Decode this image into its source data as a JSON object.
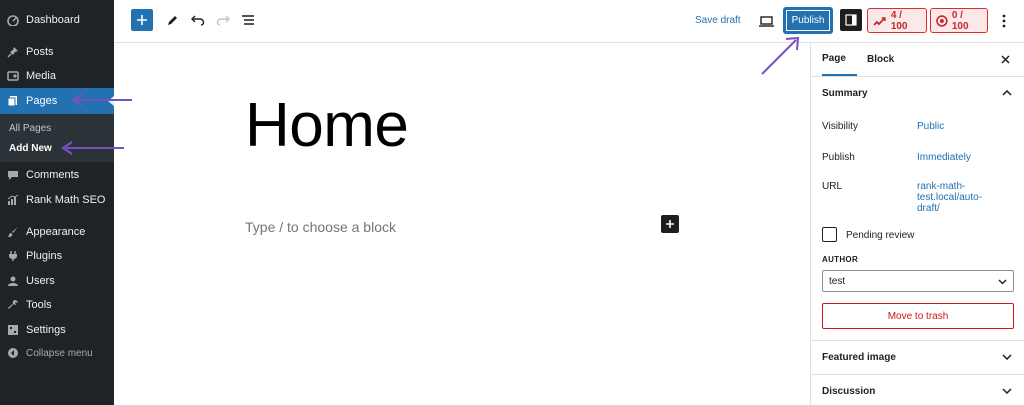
{
  "admin_menu": {
    "items": [
      {
        "label": "Dashboard",
        "icon": "dashboard-icon"
      },
      {
        "label": "Posts",
        "icon": "pin-icon"
      },
      {
        "label": "Media",
        "icon": "media-icon"
      },
      {
        "label": "Pages",
        "icon": "pages-icon",
        "active": true
      },
      {
        "label": "Comments",
        "icon": "comment-icon"
      },
      {
        "label": "Rank Math SEO",
        "icon": "chart-icon"
      },
      {
        "label": "Appearance",
        "icon": "brush-icon"
      },
      {
        "label": "Plugins",
        "icon": "plugin-icon"
      },
      {
        "label": "Users",
        "icon": "user-icon"
      },
      {
        "label": "Tools",
        "icon": "wrench-icon"
      },
      {
        "label": "Settings",
        "icon": "settings-icon"
      },
      {
        "label": "Collapse menu",
        "icon": "collapse-icon"
      }
    ],
    "submenu": [
      "All Pages",
      "Add New"
    ]
  },
  "toolbar": {
    "save_draft": "Save draft",
    "publish": "Publish",
    "seo_score": "4 / 100",
    "content_score": "0 / 100"
  },
  "editor": {
    "title": "Home",
    "placeholder": "Type / to choose a block"
  },
  "settings_panel": {
    "tabs": [
      "Page",
      "Block"
    ],
    "summary_title": "Summary",
    "visibility_label": "Visibility",
    "visibility_value": "Public",
    "publish_label": "Publish",
    "publish_value": "Immediately",
    "url_label": "URL",
    "url_lines": [
      "rank-math-",
      "test.local/auto-",
      "draft/"
    ],
    "pending_review": "Pending review",
    "author_label": "AUTHOR",
    "author_value": "test",
    "trash_label": "Move to trash",
    "featured_image": "Featured image",
    "discussion": "Discussion"
  },
  "colors": {
    "admin_bg": "#1d2327",
    "accent": "#2271b1",
    "annotation_arrow": "#7b4fc4",
    "danger": "#cc1818"
  }
}
